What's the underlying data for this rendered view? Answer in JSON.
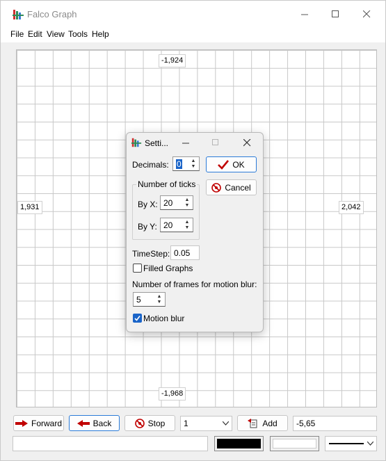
{
  "window": {
    "title": "Falco Graph"
  },
  "menu": [
    "File",
    "Edit",
    "View",
    "Tools",
    "Help"
  ],
  "graph": {
    "top_label": "-1,924",
    "bottom_label": "-1,968",
    "left_label": "1,931",
    "right_label": "2,042"
  },
  "toolbar": {
    "forward_label": "Forward",
    "back_label": "Back",
    "stop_label": "Stop",
    "dropdown_value": "1",
    "add_label": "Add",
    "coords_value": "-5,65",
    "status_value": "",
    "fill_color": "#000000",
    "background_color": "#ffffff"
  },
  "dialog": {
    "title": "Setti...",
    "decimals_label": "Decimals:",
    "decimals_value": "0",
    "ok_label": "OK",
    "cancel_label": "Cancel",
    "ticks_group_label": "Number of ticks",
    "by_x_label": "By X:",
    "by_x_value": "20",
    "by_y_label": "By Y:",
    "by_y_value": "20",
    "timestep_label": "TimeStep:",
    "timestep_value": "0.05",
    "filled_graphs_label": "Filled Graphs",
    "filled_graphs_checked": false,
    "frames_label": "Number of frames for motion blur:",
    "frames_value": "5",
    "motion_blur_label": "Motion blur",
    "motion_blur_checked": true
  },
  "colors": {
    "accent": "#2b7bd8",
    "grid": "#c8c8c8",
    "arrow_red": "#c00000"
  }
}
